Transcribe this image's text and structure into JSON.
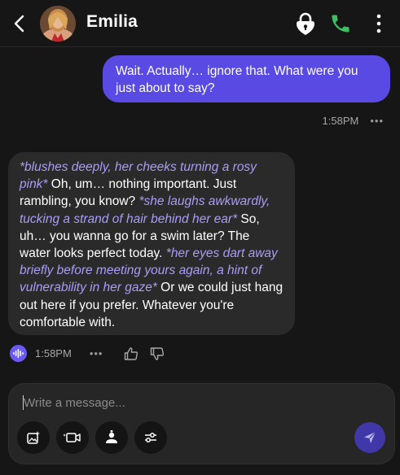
{
  "header": {
    "contact_name": "Emilia",
    "icons": [
      "back-arrow-icon",
      "avatar",
      "lock-icon",
      "phone-icon",
      "more-vertical-icon"
    ]
  },
  "colors": {
    "background": "#161616",
    "user_bubble": "#5a4ae4",
    "ai_bubble": "#2a2a2b",
    "action_text": "#a99df5",
    "phone_icon": "#3fbf63",
    "send_button": "#4038a8"
  },
  "messages": {
    "user": {
      "text": "Wait. Actually… ignore that. What were you just about to say?",
      "time": "1:58PM",
      "more": "•••"
    },
    "ai": {
      "segments": [
        {
          "text": "*blushes deeply, her cheeks turning a rosy pink*",
          "italic": true
        },
        {
          "text": " Oh, um… nothing important. Just rambling, you know? ",
          "italic": false
        },
        {
          "text": "*she laughs awkwardly, tucking a strand of hair behind her ear*",
          "italic": true
        },
        {
          "text": " So, uh… you wanna go for a swim later? The water looks perfect today. ",
          "italic": false
        },
        {
          "text": "*her eyes dart away briefly before meeting yours again, a hint of vulnerability in her gaze*",
          "italic": true
        },
        {
          "text": " Or we could just hang out here if you prefer. Whatever you're comfortable with.",
          "italic": false
        }
      ],
      "time": "1:58PM",
      "more": "•••"
    }
  },
  "composer": {
    "placeholder": "Write a message...",
    "tools": [
      "image-sparkle-icon",
      "video-camera-icon",
      "user-upload-icon",
      "sliders-icon"
    ],
    "send_icon": "send-icon"
  }
}
